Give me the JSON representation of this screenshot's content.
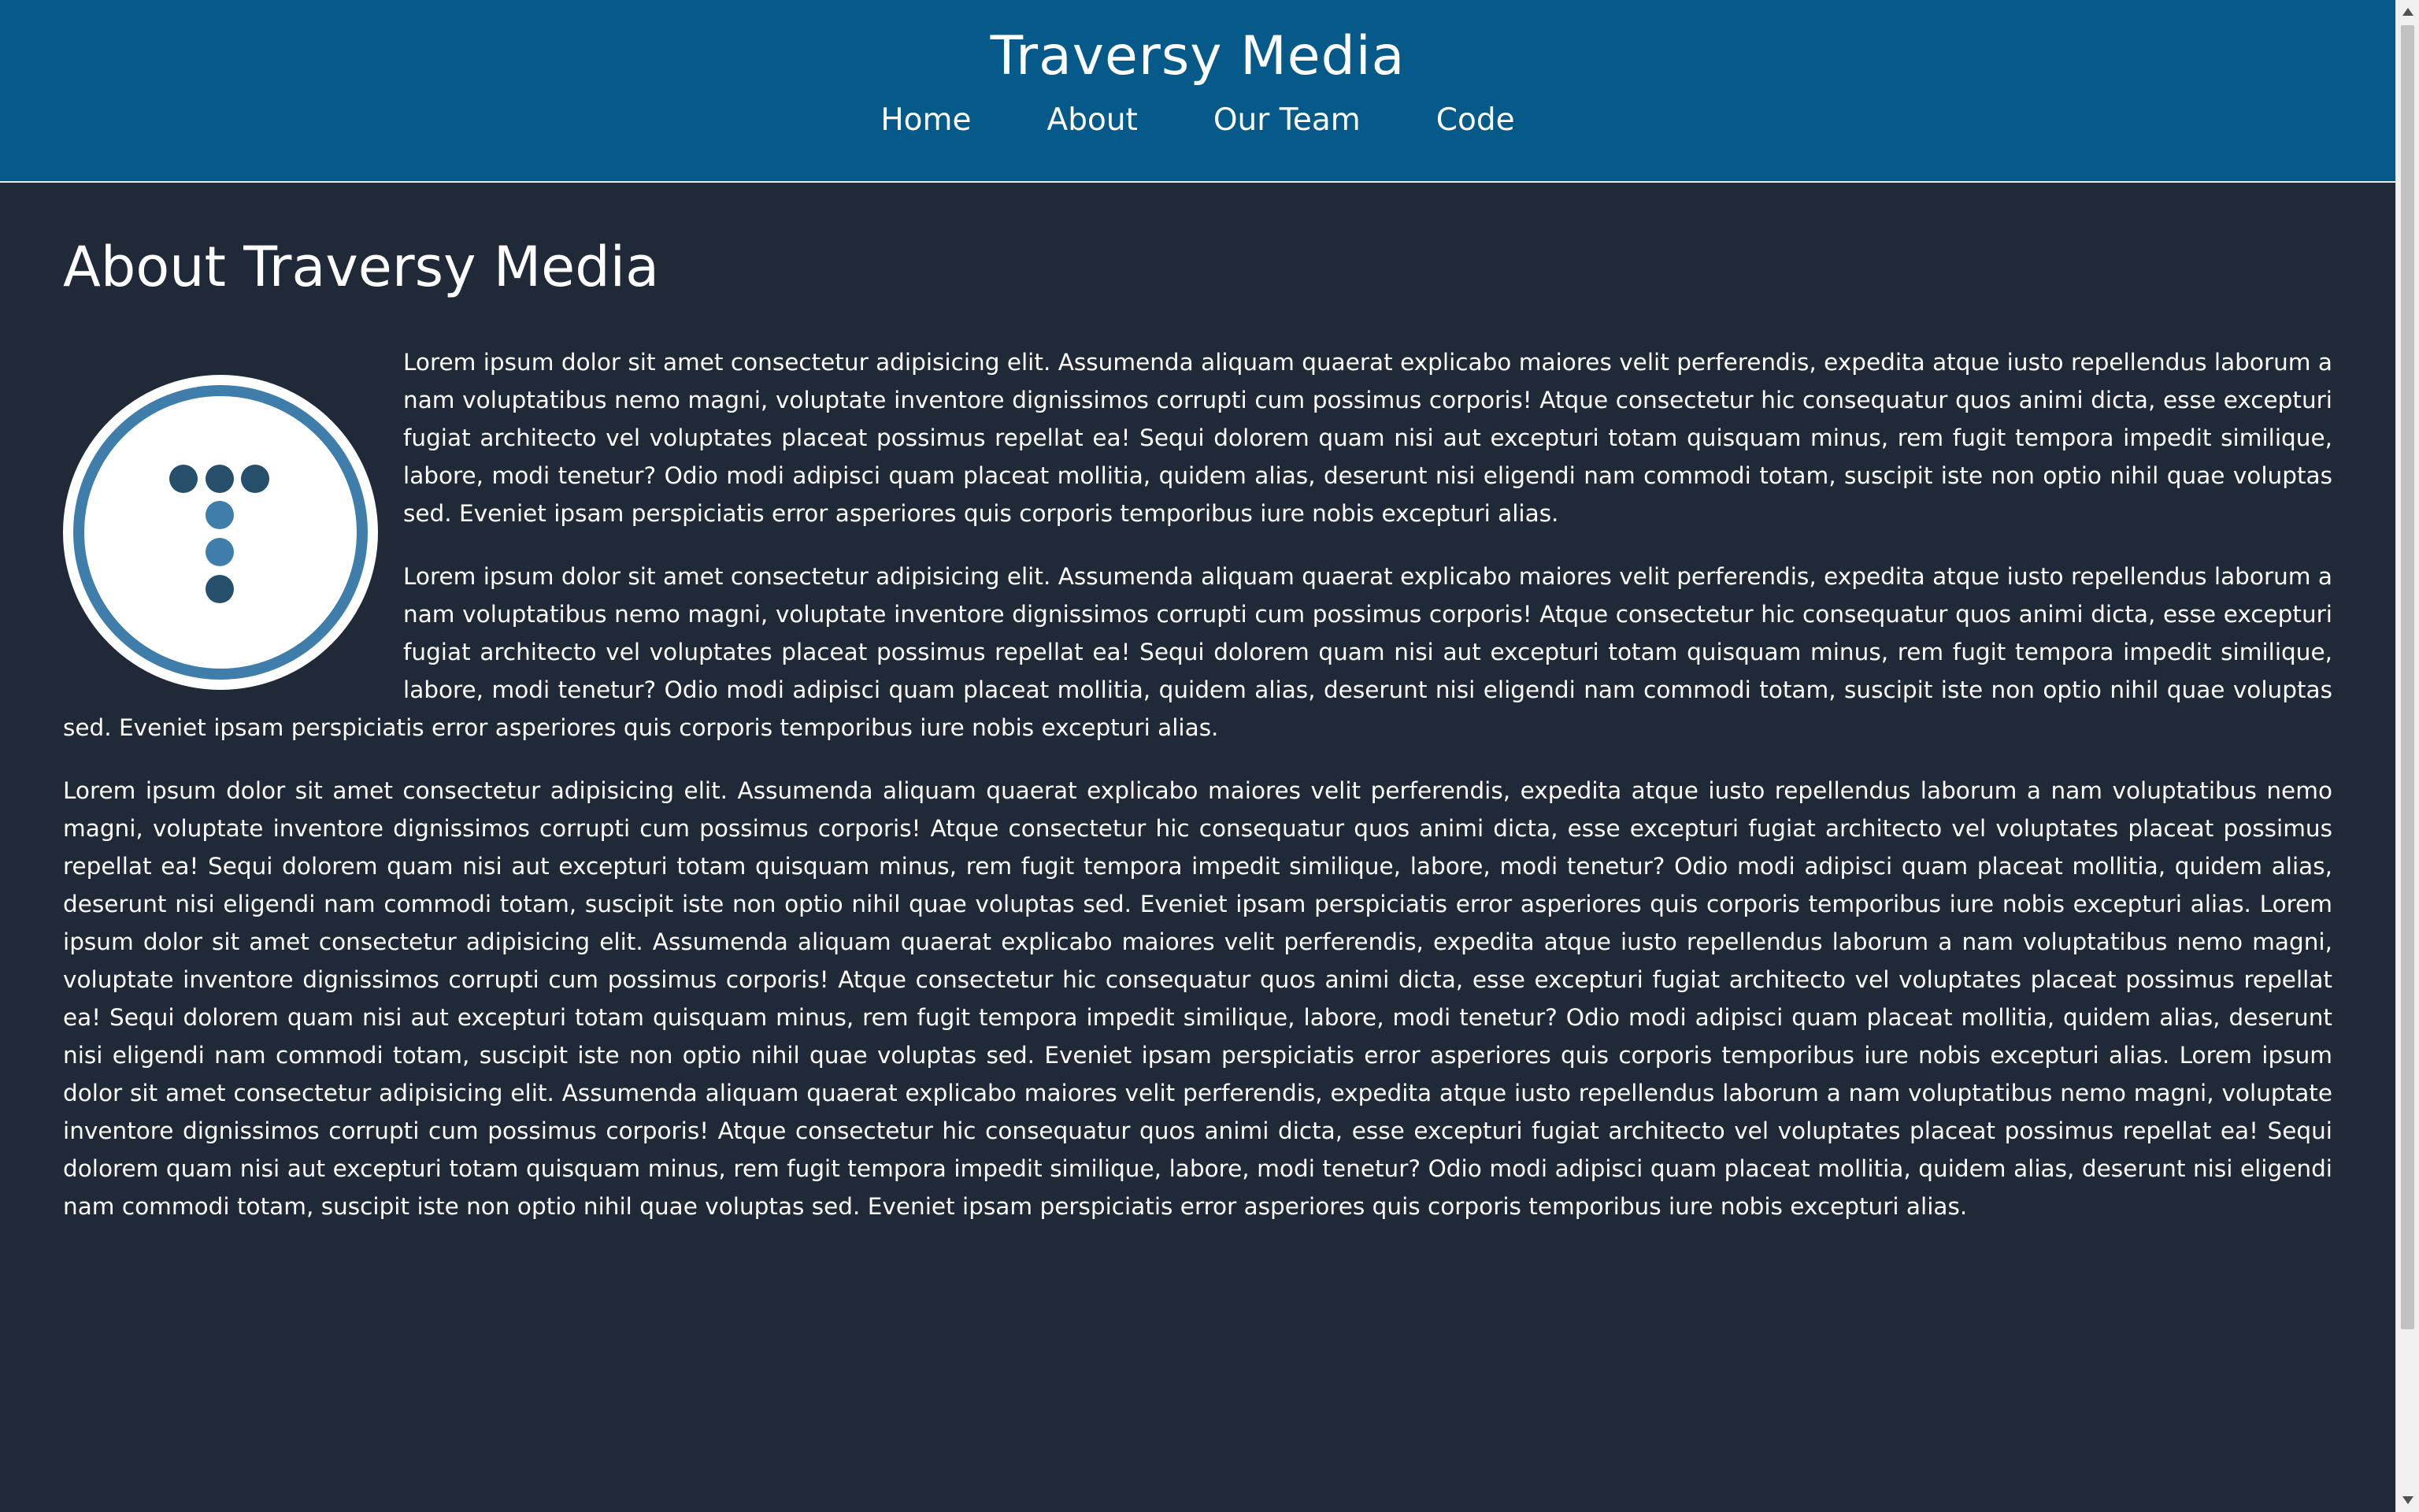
{
  "header": {
    "site_title": "Traversy Media",
    "nav": [
      "Home",
      "About",
      "Our Team",
      "Code"
    ]
  },
  "main": {
    "title": "About Traversy Media",
    "logo_icon": "traversy-media-logo-icon",
    "paragraphs": [
      "Lorem ipsum dolor sit amet consectetur adipisicing elit. Assumenda aliquam quaerat explicabo maiores velit perferendis, expedita atque iusto repellendus laborum a nam voluptatibus nemo magni, voluptate inventore dignissimos corrupti cum possimus corporis! Atque consectetur hic consequatur quos animi dicta, esse excepturi fugiat architecto vel voluptates placeat possimus repellat ea! Sequi dolorem quam nisi aut excepturi totam quisquam minus, rem fugit tempora impedit similique, labore, modi tenetur? Odio modi adipisci quam placeat mollitia, quidem alias, deserunt nisi eligendi nam commodi totam, suscipit iste non optio nihil quae voluptas sed. Eveniet ipsam perspiciatis error asperiores quis corporis temporibus iure nobis excepturi alias.",
      "Lorem ipsum dolor sit amet consectetur adipisicing elit. Assumenda aliquam quaerat explicabo maiores velit perferendis, expedita atque iusto repellendus laborum a nam voluptatibus nemo magni, voluptate inventore dignissimos corrupti cum possimus corporis! Atque consectetur hic consequatur quos animi dicta, esse excepturi fugiat architecto vel voluptates placeat possimus repellat ea! Sequi dolorem quam nisi aut excepturi totam quisquam minus, rem fugit tempora impedit similique, labore, modi tenetur? Odio modi adipisci quam placeat mollitia, quidem alias, deserunt nisi eligendi nam commodi totam, suscipit iste non optio nihil quae voluptas sed. Eveniet ipsam perspiciatis error asperiores quis corporis temporibus iure nobis excepturi alias.",
      "Lorem ipsum dolor sit amet consectetur adipisicing elit. Assumenda aliquam quaerat explicabo maiores velit perferendis, expedita atque iusto repellendus laborum a nam voluptatibus nemo magni, voluptate inventore dignissimos corrupti cum possimus corporis! Atque consectetur hic consequatur quos animi dicta, esse excepturi fugiat architecto vel voluptates placeat possimus repellat ea! Sequi dolorem quam nisi aut excepturi totam quisquam minus, rem fugit tempora impedit similique, labore, modi tenetur? Odio modi adipisci quam placeat mollitia, quidem alias, deserunt nisi eligendi nam commodi totam, suscipit iste non optio nihil quae voluptas sed. Eveniet ipsam perspiciatis error asperiores quis corporis temporibus iure nobis excepturi alias. Lorem ipsum dolor sit amet consectetur adipisicing elit. Assumenda aliquam quaerat explicabo maiores velit perferendis, expedita atque iusto repellendus laborum a nam voluptatibus nemo magni, voluptate inventore dignissimos corrupti cum possimus corporis! Atque consectetur hic consequatur quos animi dicta, esse excepturi fugiat architecto vel voluptates placeat possimus repellat ea! Sequi dolorem quam nisi aut excepturi totam quisquam minus, rem fugit tempora impedit similique, labore, modi tenetur? Odio modi adipisci quam placeat mollitia, quidem alias, deserunt nisi eligendi nam commodi totam, suscipit iste non optio nihil quae voluptas sed. Eveniet ipsam perspiciatis error asperiores quis corporis temporibus iure nobis excepturi alias. Lorem ipsum dolor sit amet consectetur adipisicing elit. Assumenda aliquam quaerat explicabo maiores velit perferendis, expedita atque iusto repellendus laborum a nam voluptatibus nemo magni, voluptate inventore dignissimos corrupti cum possimus corporis! Atque consectetur hic consequatur quos animi dicta, esse excepturi fugiat architecto vel voluptates placeat possimus repellat ea! Sequi dolorem quam nisi aut excepturi totam quisquam minus, rem fugit tempora impedit similique, labore, modi tenetur? Odio modi adipisci quam placeat mollitia, quidem alias, deserunt nisi eligendi nam commodi totam, suscipit iste non optio nihil quae voluptas sed. Eveniet ipsam perspiciatis error asperiores quis corporis temporibus iure nobis excepturi alias."
    ]
  },
  "colors": {
    "header_bg": "#055a89",
    "page_bg": "#1f2937",
    "logo_ring": "#3f7daa",
    "logo_dot_dark": "#264f6c",
    "logo_dot_light": "#3f7daa"
  }
}
